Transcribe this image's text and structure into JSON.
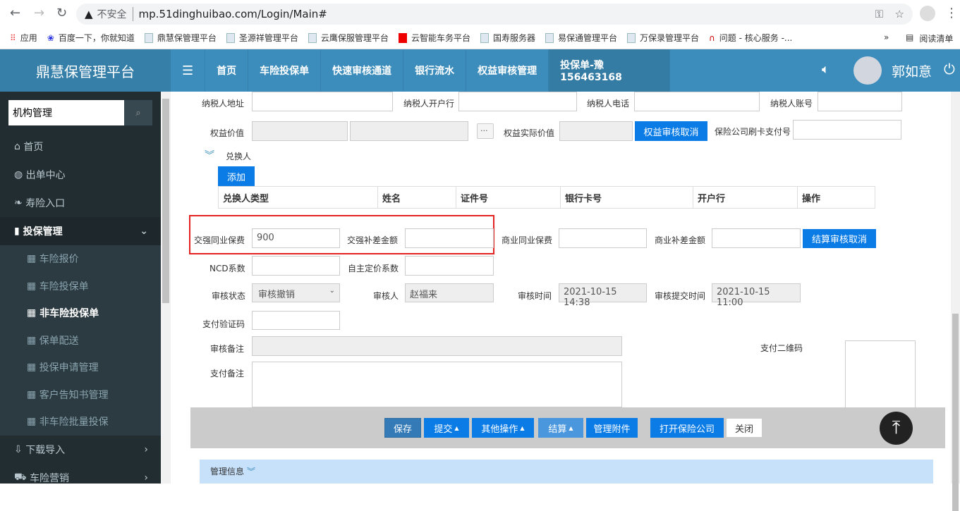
{
  "browser": {
    "security": "不安全",
    "url": "mp.51dinghuibao.com/Login/Main#",
    "bookmarks": [
      "应用",
      "百度一下，你就知道",
      "鼎慧保管理平台",
      "圣源祥管理平台",
      "云鹰保服管理平台",
      "云智能车务平台",
      "国寿服务器",
      "易保通管理平台",
      "万保录管理平台",
      "问题 - 核心服务 -..."
    ],
    "more": "»",
    "reading_list": "阅读清单"
  },
  "header": {
    "brand": "鼎慧保管理平台",
    "tabs": [
      "首页",
      "车险投保单",
      "快速审核通道",
      "银行流水",
      "权益审核管理",
      "投保单-豫156463168"
    ],
    "user": "郭如意"
  },
  "sidebar": {
    "search_value": "机构管理",
    "items": [
      {
        "label": "首页"
      },
      {
        "label": "出单中心"
      },
      {
        "label": "寿险入口"
      },
      {
        "label": "投保管理"
      },
      {
        "label": "车险报价"
      },
      {
        "label": "车险投保单"
      },
      {
        "label": "非车险投保单"
      },
      {
        "label": "保单配送"
      },
      {
        "label": "投保申请管理"
      },
      {
        "label": "客户告知书管理"
      },
      {
        "label": "非车险批量投保"
      },
      {
        "label": "下载导入"
      },
      {
        "label": "车险营销"
      }
    ]
  },
  "form": {
    "taxpayer_address": "纳税人地址",
    "taxpayer_bank": "纳税人开户行",
    "taxpayer_phone": "纳税人电话",
    "taxpayer_account": "纳税人账号",
    "equity_value": "权益价值",
    "ellipsis": "...",
    "equity_actual_value": "权益实际价值",
    "equity_cancel": "权益审核取消",
    "card_pay_no": "保险公司刷卡支付号",
    "exchanger": "兑换人",
    "add": "添加",
    "exchanger_columns": [
      "兑换人类型",
      "姓名",
      "证件号",
      "银行卡号",
      "开户行",
      "操作"
    ],
    "ctp_peer_premium": "交强同业保费",
    "ctp_peer_premium_value": "900",
    "ctp_diff": "交强补差金额",
    "com_peer_premium": "商业同业保费",
    "com_diff": "商业补差金额",
    "settle_cancel": "结算审核取消",
    "ncd": "NCD系数",
    "self_pricing": "自主定价系数",
    "audit_status": "审核状态",
    "audit_status_value": "审核撤销",
    "auditor": "审核人",
    "auditor_value": "赵福来",
    "audit_time": "审核时间",
    "audit_time_value": "2021-10-15 14:38",
    "submit_time": "审核提交时间",
    "submit_time_value": "2021-10-15 11:00",
    "pay_code": "支付验证码",
    "audit_remark": "审核备注",
    "pay_qr": "支付二维码",
    "pay_remark": "支付备注"
  },
  "toolbar": {
    "save": "保存",
    "submit": "提交",
    "other": "其他操作",
    "settle": "结算",
    "attachments": "管理附件",
    "open_insurer": "打开保险公司",
    "close": "关闭"
  },
  "manage_info": "管理信息"
}
